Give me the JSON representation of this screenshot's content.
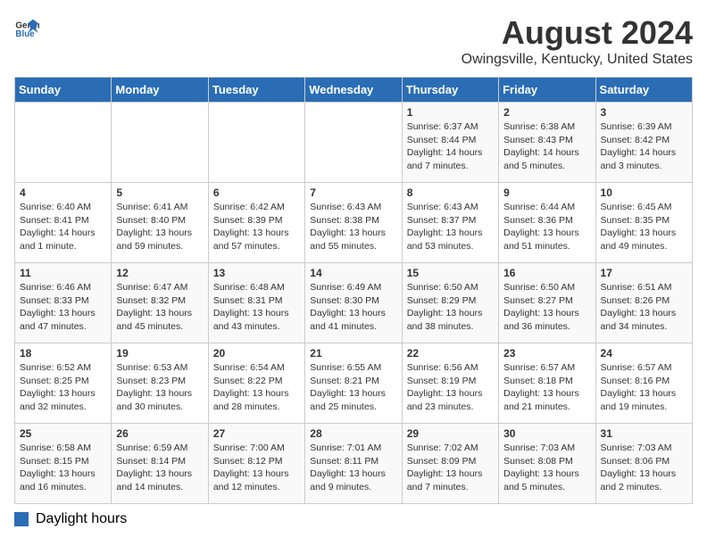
{
  "logo": {
    "line1": "General",
    "line2": "Blue"
  },
  "title": "August 2024",
  "subtitle": "Owingsville, Kentucky, United States",
  "days_of_week": [
    "Sunday",
    "Monday",
    "Tuesday",
    "Wednesday",
    "Thursday",
    "Friday",
    "Saturday"
  ],
  "weeks": [
    [
      {
        "num": "",
        "info": ""
      },
      {
        "num": "",
        "info": ""
      },
      {
        "num": "",
        "info": ""
      },
      {
        "num": "",
        "info": ""
      },
      {
        "num": "1",
        "info": "Sunrise: 6:37 AM\nSunset: 8:44 PM\nDaylight: 14 hours and 7 minutes."
      },
      {
        "num": "2",
        "info": "Sunrise: 6:38 AM\nSunset: 8:43 PM\nDaylight: 14 hours and 5 minutes."
      },
      {
        "num": "3",
        "info": "Sunrise: 6:39 AM\nSunset: 8:42 PM\nDaylight: 14 hours and 3 minutes."
      }
    ],
    [
      {
        "num": "4",
        "info": "Sunrise: 6:40 AM\nSunset: 8:41 PM\nDaylight: 14 hours and 1 minute."
      },
      {
        "num": "5",
        "info": "Sunrise: 6:41 AM\nSunset: 8:40 PM\nDaylight: 13 hours and 59 minutes."
      },
      {
        "num": "6",
        "info": "Sunrise: 6:42 AM\nSunset: 8:39 PM\nDaylight: 13 hours and 57 minutes."
      },
      {
        "num": "7",
        "info": "Sunrise: 6:43 AM\nSunset: 8:38 PM\nDaylight: 13 hours and 55 minutes."
      },
      {
        "num": "8",
        "info": "Sunrise: 6:43 AM\nSunset: 8:37 PM\nDaylight: 13 hours and 53 minutes."
      },
      {
        "num": "9",
        "info": "Sunrise: 6:44 AM\nSunset: 8:36 PM\nDaylight: 13 hours and 51 minutes."
      },
      {
        "num": "10",
        "info": "Sunrise: 6:45 AM\nSunset: 8:35 PM\nDaylight: 13 hours and 49 minutes."
      }
    ],
    [
      {
        "num": "11",
        "info": "Sunrise: 6:46 AM\nSunset: 8:33 PM\nDaylight: 13 hours and 47 minutes."
      },
      {
        "num": "12",
        "info": "Sunrise: 6:47 AM\nSunset: 8:32 PM\nDaylight: 13 hours and 45 minutes."
      },
      {
        "num": "13",
        "info": "Sunrise: 6:48 AM\nSunset: 8:31 PM\nDaylight: 13 hours and 43 minutes."
      },
      {
        "num": "14",
        "info": "Sunrise: 6:49 AM\nSunset: 8:30 PM\nDaylight: 13 hours and 41 minutes."
      },
      {
        "num": "15",
        "info": "Sunrise: 6:50 AM\nSunset: 8:29 PM\nDaylight: 13 hours and 38 minutes."
      },
      {
        "num": "16",
        "info": "Sunrise: 6:50 AM\nSunset: 8:27 PM\nDaylight: 13 hours and 36 minutes."
      },
      {
        "num": "17",
        "info": "Sunrise: 6:51 AM\nSunset: 8:26 PM\nDaylight: 13 hours and 34 minutes."
      }
    ],
    [
      {
        "num": "18",
        "info": "Sunrise: 6:52 AM\nSunset: 8:25 PM\nDaylight: 13 hours and 32 minutes."
      },
      {
        "num": "19",
        "info": "Sunrise: 6:53 AM\nSunset: 8:23 PM\nDaylight: 13 hours and 30 minutes."
      },
      {
        "num": "20",
        "info": "Sunrise: 6:54 AM\nSunset: 8:22 PM\nDaylight: 13 hours and 28 minutes."
      },
      {
        "num": "21",
        "info": "Sunrise: 6:55 AM\nSunset: 8:21 PM\nDaylight: 13 hours and 25 minutes."
      },
      {
        "num": "22",
        "info": "Sunrise: 6:56 AM\nSunset: 8:19 PM\nDaylight: 13 hours and 23 minutes."
      },
      {
        "num": "23",
        "info": "Sunrise: 6:57 AM\nSunset: 8:18 PM\nDaylight: 13 hours and 21 minutes."
      },
      {
        "num": "24",
        "info": "Sunrise: 6:57 AM\nSunset: 8:16 PM\nDaylight: 13 hours and 19 minutes."
      }
    ],
    [
      {
        "num": "25",
        "info": "Sunrise: 6:58 AM\nSunset: 8:15 PM\nDaylight: 13 hours and 16 minutes."
      },
      {
        "num": "26",
        "info": "Sunrise: 6:59 AM\nSunset: 8:14 PM\nDaylight: 13 hours and 14 minutes."
      },
      {
        "num": "27",
        "info": "Sunrise: 7:00 AM\nSunset: 8:12 PM\nDaylight: 13 hours and 12 minutes."
      },
      {
        "num": "28",
        "info": "Sunrise: 7:01 AM\nSunset: 8:11 PM\nDaylight: 13 hours and 9 minutes."
      },
      {
        "num": "29",
        "info": "Sunrise: 7:02 AM\nSunset: 8:09 PM\nDaylight: 13 hours and 7 minutes."
      },
      {
        "num": "30",
        "info": "Sunrise: 7:03 AM\nSunset: 8:08 PM\nDaylight: 13 hours and 5 minutes."
      },
      {
        "num": "31",
        "info": "Sunrise: 7:03 AM\nSunset: 8:06 PM\nDaylight: 13 hours and 2 minutes."
      }
    ]
  ],
  "legend": {
    "daylight_label": "Daylight hours"
  },
  "colors": {
    "header_bg": "#2a6db5",
    "header_text": "#ffffff",
    "row_odd": "#f9f9f9",
    "row_even": "#ffffff"
  }
}
